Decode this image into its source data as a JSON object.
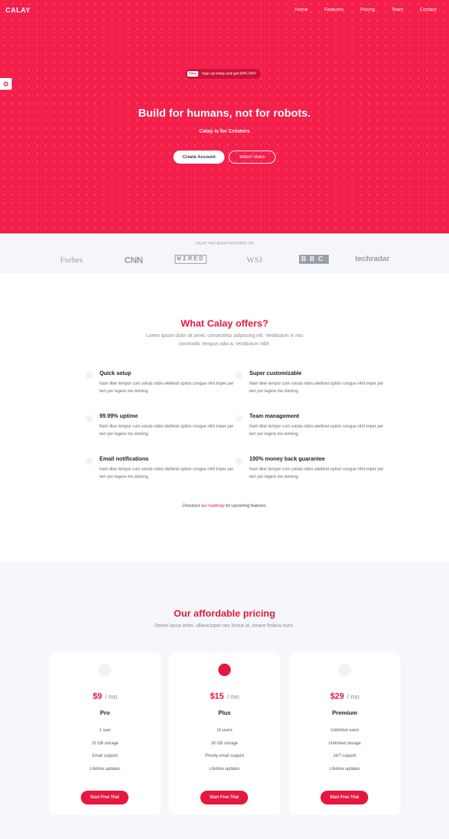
{
  "header": {
    "logo": "CALAY",
    "nav": [
      "Home",
      "Features",
      "Pricing",
      "Team",
      "Contact"
    ]
  },
  "hero": {
    "badge": "New",
    "promo": "Sign up today and get 50% OFF",
    "title": "Build for humans, not for robots.",
    "subtitle": "Calay is for Creators",
    "primary_button": "Create Account",
    "secondary_button": "Watch Video"
  },
  "featured": {
    "title": "CALAY HAS BEEN FEATURED ON",
    "brands": [
      "Forbes",
      "CNN",
      "WIRED",
      "WSJ",
      "BBC",
      "techradar"
    ]
  },
  "features": {
    "title": "What Calay offers?",
    "subtitle": "Lorem ipsum dolor sit amet, consectetur adipiscing elit. Vestibulum in nisi commodo, tempus odio a, vestibulum nibh.",
    "items": [
      {
        "title": "Quick setup",
        "desc": "Nam liber tempor cum soluta nobis eleifend option congue nihil imper per tem por legere me doming."
      },
      {
        "title": "Super customizable",
        "desc": "Nam liber tempor cum soluta nobis eleifend option congue nihil imper per tem por legere me doming."
      },
      {
        "title": "99.99% uptime",
        "desc": "Nam liber tempor cum soluta nobis eleifend option congue nihil imper per tem por legere me doming."
      },
      {
        "title": "Team management",
        "desc": "Nam liber tempor cum soluta nobis eleifend option congue nihil imper per tem por legere me doming."
      },
      {
        "title": "Email notifications",
        "desc": "Nam liber tempor cum soluta nobis eleifend option congue nihil imper per tem por legere me doming."
      },
      {
        "title": "100% money back guarantee",
        "desc": "Nam liber tempor cum soluta nobis eleifend option congue nihil imper per tem por legere me doming."
      }
    ],
    "roadmap_prefix": "Checkout",
    "roadmap_link": "our roadmap",
    "roadmap_suffix": "for upcoming features."
  },
  "pricing": {
    "title": "Our affordable pricing",
    "subtitle": "Donec lacus enim, ullamcorper nec lectus id, ornare finibus nunc.",
    "per": "/ mo",
    "plans": [
      {
        "price": "$9",
        "name": "Pro",
        "features": [
          "1 user",
          "10 GB storage",
          "Email support",
          "Lifetime updates"
        ],
        "button": "Start Free Trial"
      },
      {
        "price": "$15",
        "name": "Plus",
        "features": [
          "10 users",
          "30 GB storage",
          "Priority email support",
          "Lifetime updates"
        ],
        "button": "Start Free Trial"
      },
      {
        "price": "$29",
        "name": "Premium",
        "features": [
          "Unlimited users",
          "Unlimited storage",
          "24/7 support",
          "Lifetime updates"
        ],
        "button": "Start Free Trial"
      }
    ]
  },
  "colors": {
    "brand": "#f51f4b",
    "accent_text": "#e8173f",
    "light_bg": "#f6f7fa"
  }
}
